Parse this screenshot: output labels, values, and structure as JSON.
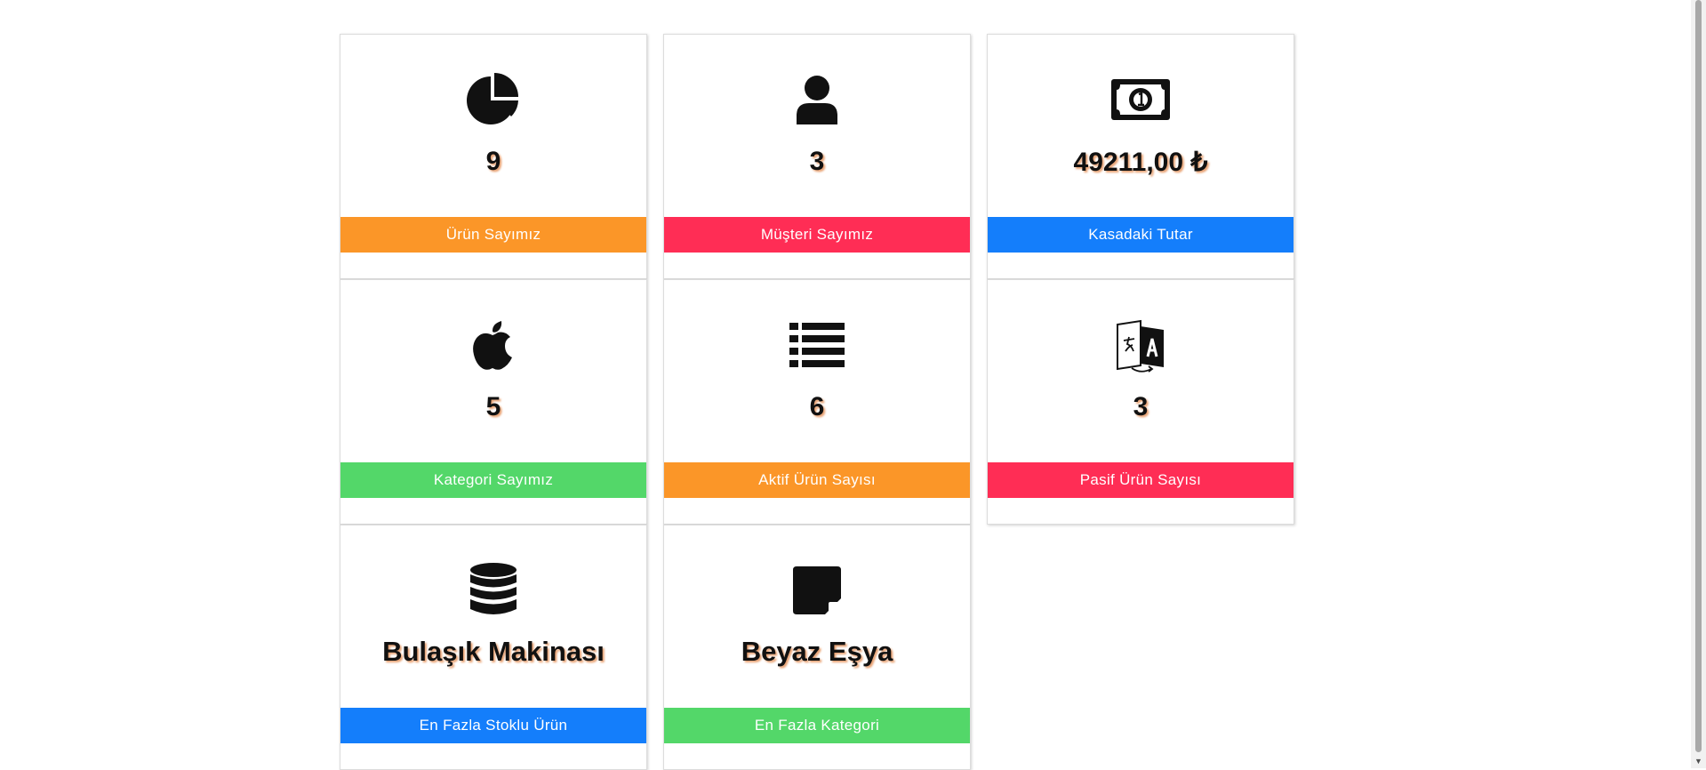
{
  "colors": {
    "orange": "#fb9628",
    "pink": "#ff2d55",
    "blue": "#147efb",
    "green": "#53d769"
  },
  "cards": [
    {
      "icon": "pie-chart-icon",
      "value": "9",
      "label": "Ürün Sayımız",
      "color": "#fb9628"
    },
    {
      "icon": "user-icon",
      "value": "3",
      "label": "Müşteri Sayımız",
      "color": "#ff2d55"
    },
    {
      "icon": "money-bill-icon",
      "value": "49211,00 ₺",
      "label": "Kasadaki Tutar",
      "color": "#147efb"
    },
    {
      "icon": "apple-icon",
      "value": "5",
      "label": "Kategori Sayımız",
      "color": "#53d769"
    },
    {
      "icon": "list-icon",
      "value": "6",
      "label": "Aktif Ürün Sayısı",
      "color": "#fb9628"
    },
    {
      "icon": "language-icon",
      "value": "3",
      "label": "Pasif Ürün Sayısı",
      "color": "#ff2d55"
    },
    {
      "icon": "database-icon",
      "value": "Bulaşık Makinası",
      "label": "En Fazla Stoklu Ürün",
      "color": "#147efb"
    },
    {
      "icon": "sticky-note-icon",
      "value": "Beyaz Eşya",
      "label": "En Fazla Kategori",
      "color": "#53d769"
    }
  ]
}
